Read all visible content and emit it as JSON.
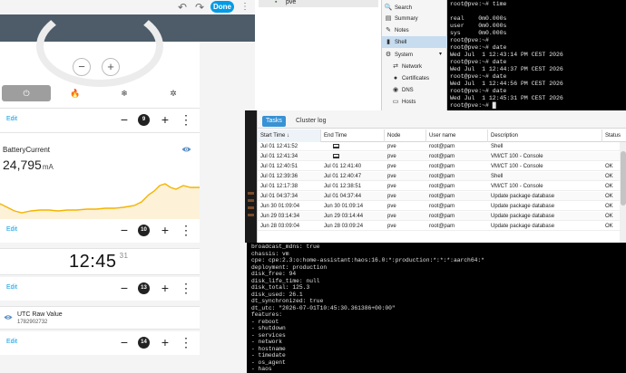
{
  "ha": {
    "topbar": {
      "undo_icon": "undo-icon",
      "redo_icon": "redo-icon",
      "done_label": "Done"
    },
    "thermostat": {
      "minus_label": "−",
      "plus_label": "+",
      "modes": [
        {
          "icon": "power-icon",
          "glyph": "⏻",
          "active": true
        },
        {
          "icon": "flame-icon",
          "glyph": "🔥",
          "active": false
        },
        {
          "icon": "snowflake-icon",
          "glyph": "❄",
          "active": false
        },
        {
          "icon": "fan-icon",
          "glyph": "✲",
          "active": false
        }
      ]
    },
    "edit_rows": [
      {
        "edit": "Edit",
        "minus": "−",
        "position": "9",
        "plus": "+",
        "menu": "⋮"
      },
      {
        "edit": "Edit",
        "minus": "−",
        "position": "10",
        "plus": "+",
        "menu": "⋮"
      },
      {
        "edit": "Edit",
        "minus": "−",
        "position": "13",
        "plus": "+",
        "menu": "⋮"
      },
      {
        "edit": "Edit",
        "minus": "−",
        "position": "14",
        "plus": "+",
        "menu": "⋮"
      }
    ],
    "battery": {
      "name": "BatteryCurrent",
      "value": "24,795",
      "unit": "mA",
      "accent": "#f4b400"
    },
    "clock": {
      "time": "12:45",
      "seconds": "31"
    },
    "utc": {
      "name": "UTC Raw Value",
      "value": "1782902732"
    }
  },
  "proxmox": {
    "tree_node": "pve",
    "menu": [
      {
        "icon": "search-icon",
        "glyph": "🔍",
        "label": "Search",
        "sub": false,
        "active": false
      },
      {
        "icon": "summary-icon",
        "glyph": "▤",
        "label": "Summary",
        "sub": false,
        "active": false
      },
      {
        "icon": "notes-icon",
        "glyph": "✎",
        "label": "Notes",
        "sub": false,
        "active": false
      },
      {
        "icon": "shell-icon",
        "glyph": "▮",
        "label": "Shell",
        "sub": false,
        "active": true
      },
      {
        "icon": "gear-icon",
        "glyph": "⚙",
        "label": "System",
        "sub": false,
        "active": false,
        "chevron": "▾"
      },
      {
        "icon": "network-icon",
        "glyph": "⇄",
        "label": "Network",
        "sub": true,
        "active": false
      },
      {
        "icon": "certificate-icon",
        "glyph": "●",
        "label": "Certificates",
        "sub": true,
        "active": false
      },
      {
        "icon": "globe-icon",
        "glyph": "◉",
        "label": "DNS",
        "sub": true,
        "active": false
      },
      {
        "icon": "hosts-icon",
        "glyph": "▭",
        "label": "Hosts",
        "sub": true,
        "active": false
      }
    ],
    "shell_lines": [
      "root@pve:~# time",
      "",
      "real    0m0.000s",
      "user    0m0.000s",
      "sys     0m0.000s",
      "root@pve:~#",
      "root@pve:~# date",
      "Wed Jul  1 12:43:14 PM CEST 2026",
      "root@pve:~# date",
      "Wed Jul  1 12:44:37 PM CEST 2026",
      "root@pve:~# date",
      "Wed Jul  1 12:44:56 PM CEST 2026",
      "root@pve:~# date",
      "Wed Jul  1 12:45:31 PM CEST 2026",
      "root@pve:~# █"
    ],
    "tasks": {
      "tab_tasks": "Tasks",
      "tab_cluster": "Cluster log",
      "columns": [
        "Start Time ↓",
        "End Time",
        "Node",
        "User name",
        "Description",
        "Status"
      ],
      "rows": [
        {
          "start": "Jul 01 12:41:52",
          "end": "",
          "running": true,
          "node": "pve",
          "user": "root@pam",
          "desc": "Shell",
          "status": ""
        },
        {
          "start": "Jul 01 12:41:34",
          "end": "",
          "running": true,
          "node": "pve",
          "user": "root@pam",
          "desc": "VM/CT 100 - Console",
          "status": ""
        },
        {
          "start": "Jul 01 12:40:51",
          "end": "Jul 01 12:41:40",
          "running": false,
          "node": "pve",
          "user": "root@pam",
          "desc": "VM/CT 100 - Console",
          "status": "OK"
        },
        {
          "start": "Jul 01 12:39:36",
          "end": "Jul 01 12:40:47",
          "running": false,
          "node": "pve",
          "user": "root@pam",
          "desc": "Shell",
          "status": "OK"
        },
        {
          "start": "Jul 01 12:17:38",
          "end": "Jul 01 12:38:51",
          "running": false,
          "node": "pve",
          "user": "root@pam",
          "desc": "VM/CT 100 - Console",
          "status": "OK"
        },
        {
          "start": "Jul 01 04:37:34",
          "end": "Jul 01 04:37:44",
          "running": false,
          "node": "pve",
          "user": "root@pam",
          "desc": "Update package database",
          "status": "OK"
        },
        {
          "start": "Jun 30 01:09:04",
          "end": "Jun 30 01:09:14",
          "running": false,
          "node": "pve",
          "user": "root@pam",
          "desc": "Update package database",
          "status": "OK"
        },
        {
          "start": "Jun 29 03:14:34",
          "end": "Jun 29 03:14:44",
          "running": false,
          "node": "pve",
          "user": "root@pam",
          "desc": "Update package database",
          "status": "OK"
        },
        {
          "start": "Jun 28 03:09:04",
          "end": "Jun 28 03:09:24",
          "running": false,
          "node": "pve",
          "user": "root@pam",
          "desc": "Update package database",
          "status": "OK"
        }
      ]
    },
    "console_lines": [
      "broadcast_mdns: true",
      "chassis: vm",
      "cpe: cpe:2.3:o:home-assistant:haos:16.0:*:production:*:*:*:aarch64:*",
      "deployment: production",
      "disk_free: 94",
      "disk_life_time: null",
      "disk_total: 125.3",
      "disk_used: 26.1",
      "dt_synchronized: true",
      "dt_utc: \"2026-07-01T10:45:30.361386+00:00\"",
      "features:",
      "- reboot",
      "- shutdown",
      "- services",
      "- network",
      "- hostname",
      "- timedate",
      "- os_agent",
      "- haos",
      "- resolved"
    ]
  }
}
